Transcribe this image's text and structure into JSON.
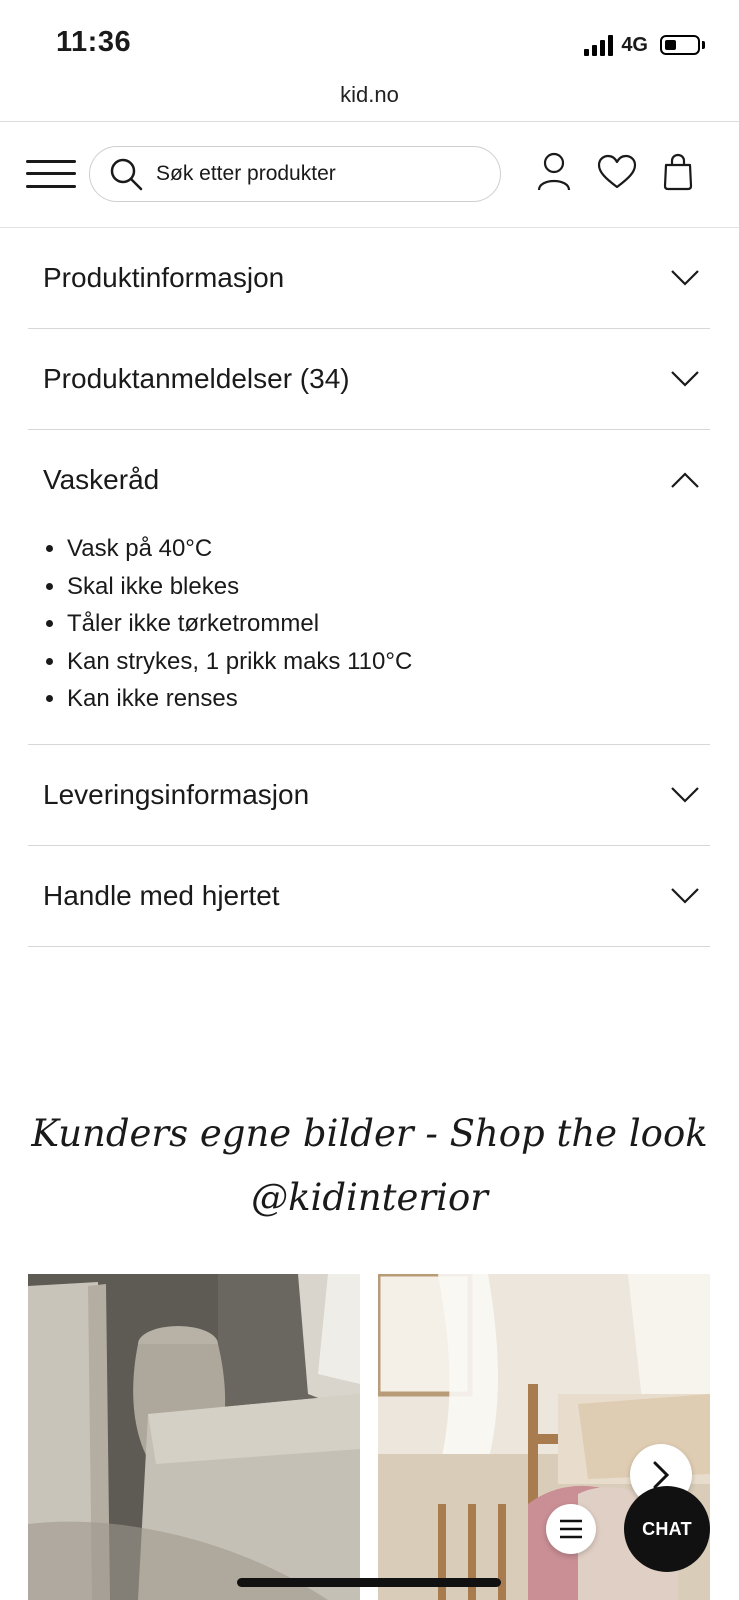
{
  "status_bar": {
    "time": "11:36",
    "network": "4G"
  },
  "browser": {
    "url": "kid.no"
  },
  "header": {
    "search_placeholder": "Søk etter produkter"
  },
  "accordion": [
    {
      "title": "Produktinformasjon",
      "expanded": false
    },
    {
      "title": "Produktanmeldelser (34)",
      "expanded": false
    },
    {
      "title": "Vaskeråd",
      "expanded": true,
      "items": [
        "Vask på 40°C",
        "Skal ikke blekes",
        "Tåler ikke tørketrommel",
        "Kan strykes, 1 prikk maks 110°C",
        "Kan ikke renses"
      ]
    },
    {
      "title": "Leveringsinformasjon",
      "expanded": false
    },
    {
      "title": "Handle med hjertet",
      "expanded": false
    }
  ],
  "shop_the_look": {
    "title_line1": "Kunders egne bilder - Shop the look",
    "title_line2": "@kidinterior"
  },
  "chat": {
    "label": "CHAT"
  },
  "colors": {
    "text": "#1a1a1a",
    "divider": "#d8d8d8",
    "chat_bg": "#111111"
  }
}
